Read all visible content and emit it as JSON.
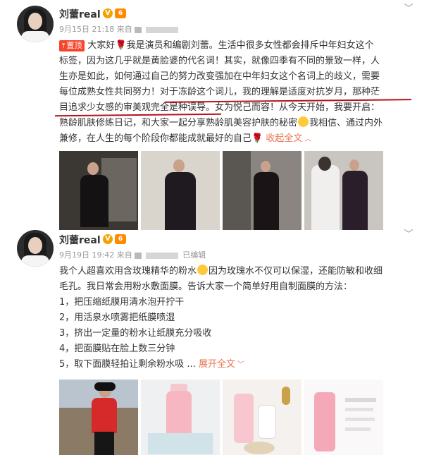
{
  "posts": [
    {
      "username": "刘蕾real",
      "vip_badge": "V",
      "level_badge": "6",
      "time": "9月15日 21:18",
      "source_prefix": "来自",
      "edited": "",
      "pin_label": "置顶",
      "text": {
        "p1": "大家好",
        "p2": "我是演员和编剧刘蕾。生活中很多女性都会排斥中年妇女这个",
        "p3": "标签，因为这几乎就是黄脸婆的代名词！其实，就像四季有不同的景致一样，人",
        "p4": "生亦是如此，如何通过自己的努力改变强加在中年妇女这个名词上的歧义，需要",
        "p5a": "每位成熟女性共同努力！",
        "p5b": "对于冻龄这个词儿，我的理解是适度对抗岁月，那种茫",
        "p6a": "目追求少女感的审美观完全是种误导。",
        "p6b": "女为悦己而容！从今天开始，我要开启：",
        "p7": "熟龄肌肤修练日记，和大家一起分享熟龄肌美容护肤的秘密",
        "p7b": "我相信、通过内外",
        "p8": "兼修，在人生的每个阶段你都能成就最好的自己",
        "collapse_label": "收起全文"
      },
      "images": [
        "photo-1",
        "photo-2",
        "photo-3",
        "photo-4"
      ]
    },
    {
      "username": "刘蕾real",
      "vip_badge": "V",
      "level_badge": "6",
      "time": "9月19日 19:42",
      "source_prefix": "来自",
      "edited": "已编辑",
      "text": {
        "l1": "我个人超喜欢用含玫瑰精华的粉水",
        "l1b": "因为玫瑰水不仅可以保湿，还能防敏和收细",
        "l2": "毛孔。我日常会用粉水敷面膜。告诉大家一个简单好用自制面膜的方法：",
        "l3": "1，把压缩纸膜用清水泡开拧干",
        "l4": "2，用活泉水喷雾把纸膜喷湿",
        "l5": "3，挤出一定量的粉水让纸膜充分吸收",
        "l6": "4，把面膜贴在脸上数三分钟",
        "l7": "5，取下面膜轻拍让剩余粉水吸 ...",
        "expand_label": "展开全文"
      },
      "images": [
        "photo-5",
        "photo-6",
        "photo-7",
        "photo-8"
      ]
    }
  ],
  "icons": {
    "chevron": "﹀",
    "pin": "⤒",
    "expand_arrow": "﹀",
    "collapse_arrow": "︿",
    "rose": "🌹"
  },
  "colors": {
    "link": "#eb7350",
    "pin_bg": "#f5462d",
    "underline": "#b5121b",
    "vip": "#f7a100"
  }
}
